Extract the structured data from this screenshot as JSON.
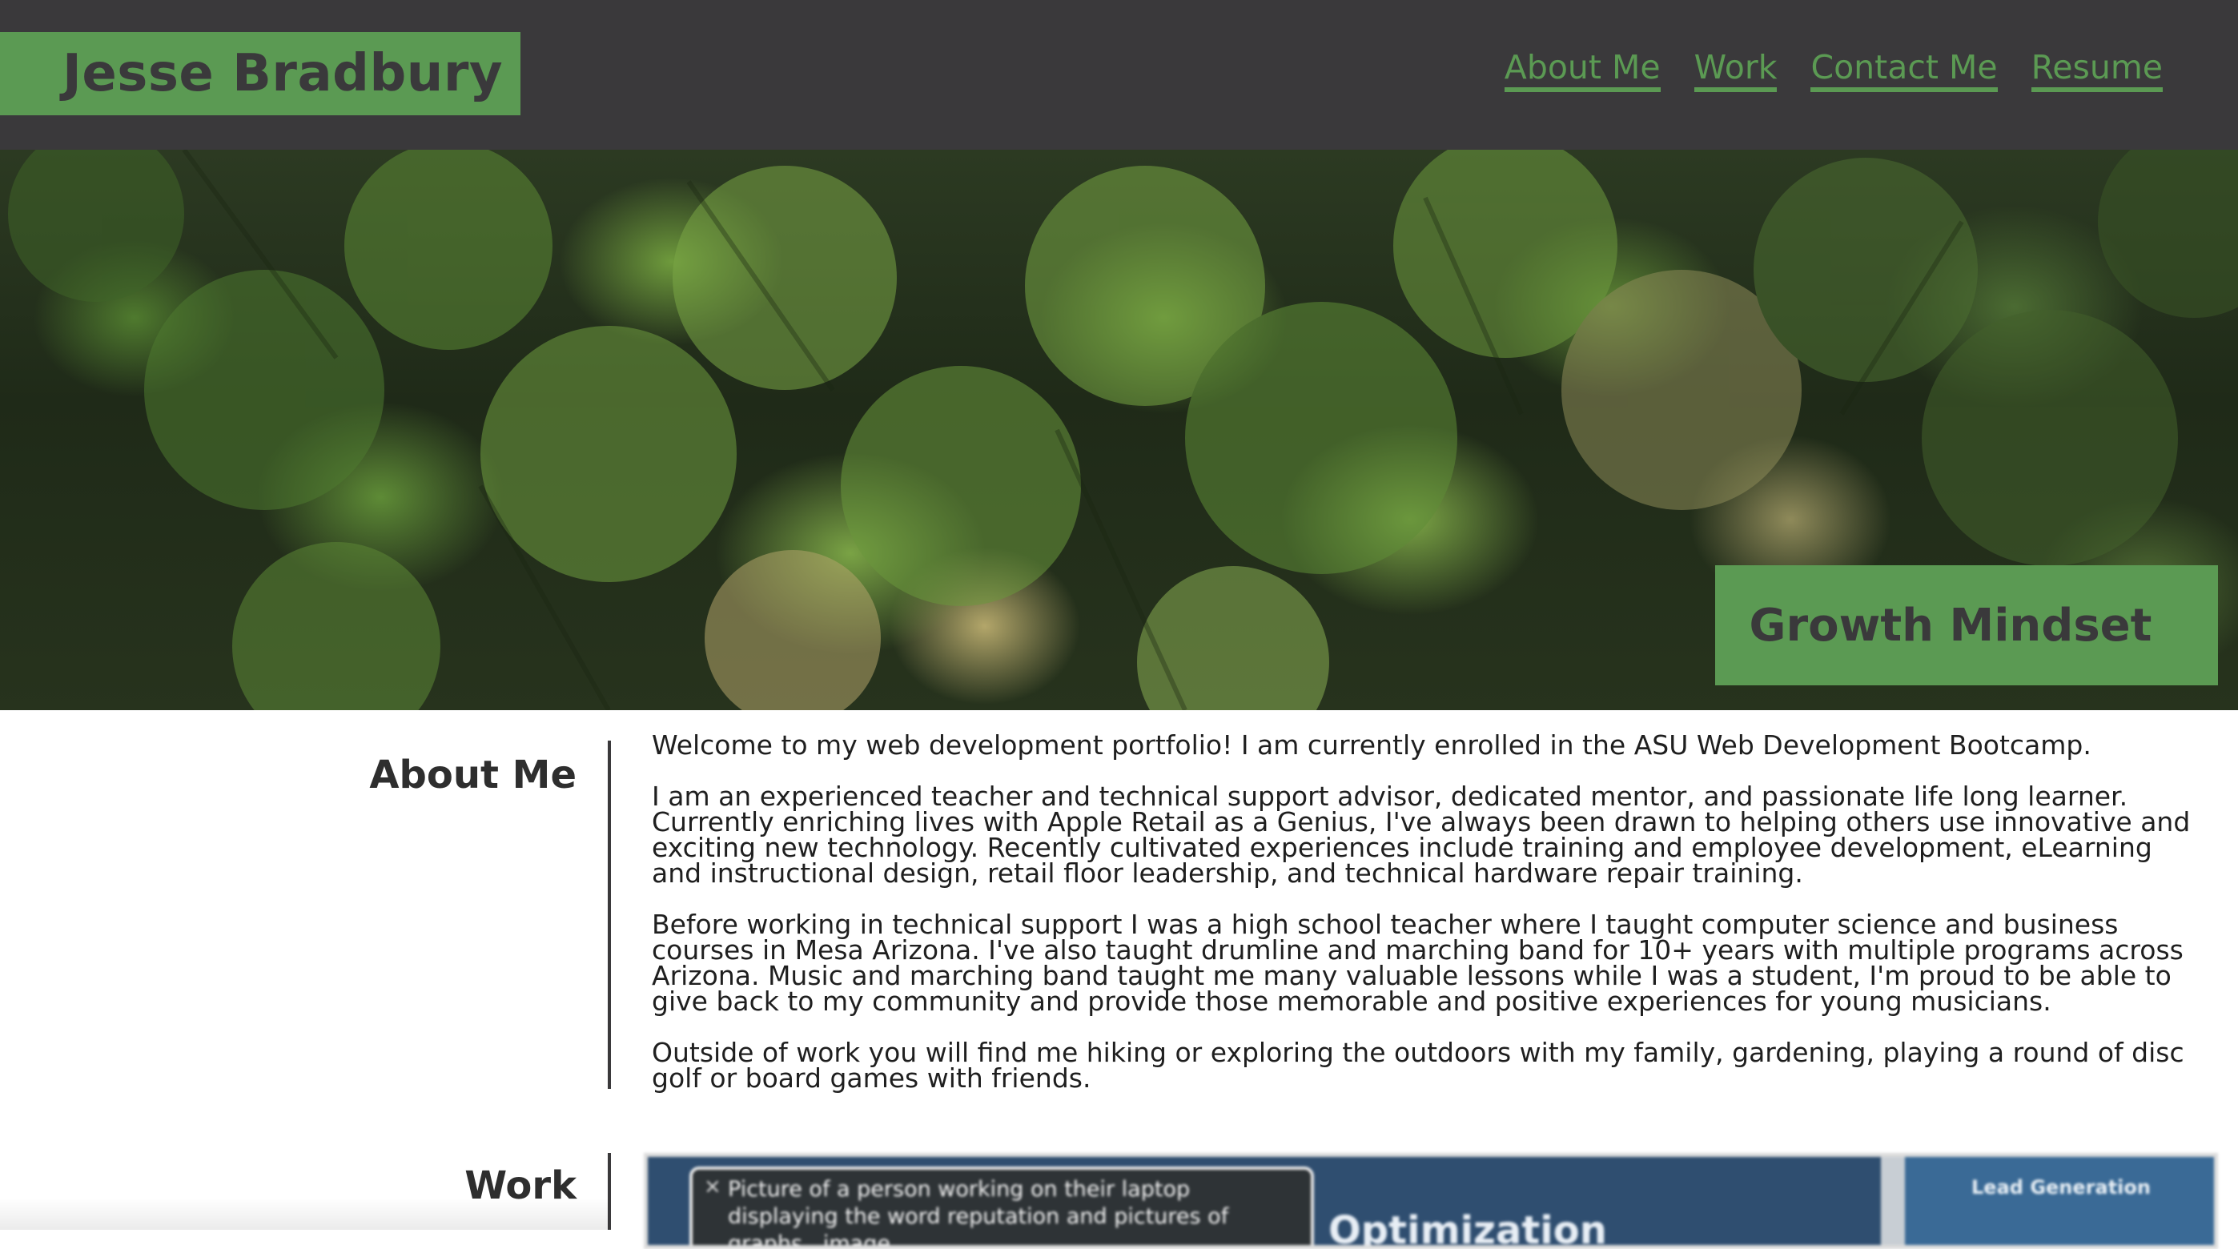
{
  "header": {
    "brand": "Jesse Bradbury",
    "nav": [
      {
        "label": "About Me"
      },
      {
        "label": "Work"
      },
      {
        "label": "Contact Me"
      },
      {
        "label": "Resume"
      }
    ]
  },
  "hero": {
    "badge": "Growth Mindset"
  },
  "about": {
    "title": "About Me",
    "paragraphs": [
      "Welcome to my web development portfolio! I am currently enrolled in the ASU Web Development Bootcamp.",
      "I am an experienced teacher and technical support advisor, dedicated mentor, and passionate life long learner. Currently enriching lives with Apple Retail as a Genius, I've always been drawn to helping others use innovative and exciting new technology. Recently cultivated experiences include training and employee development, eLearning and instructional design, retail floor leadership, and technical hardware repair training.",
      "Before working in technical support I was a high school teacher where I taught computer science and business courses in Mesa Arizona. I've also taught drumline and marching band for 10+ years with multiple programs across Arizona. Music and marching band taught me many valuable lessons while I was a student, I'm proud to be able to give back to my community and provide those memorable and positive experiences for young musicians.",
      "Outside of work you will find me hiking or exploring the outdoors with my family, gardening, playing a round of disc golf or board games with friends."
    ]
  },
  "work": {
    "title": "Work",
    "preview": {
      "caption": "Picture of a person working on their laptop displaying the word reputation and pictures of graphs., image",
      "close_glyph": "×",
      "heading": "Optimization",
      "side_label": "Lead Generation"
    }
  },
  "colors": {
    "header_bg": "#3a393b",
    "accent_green": "#5b9a53",
    "text_dark": "#2b2b2b"
  }
}
